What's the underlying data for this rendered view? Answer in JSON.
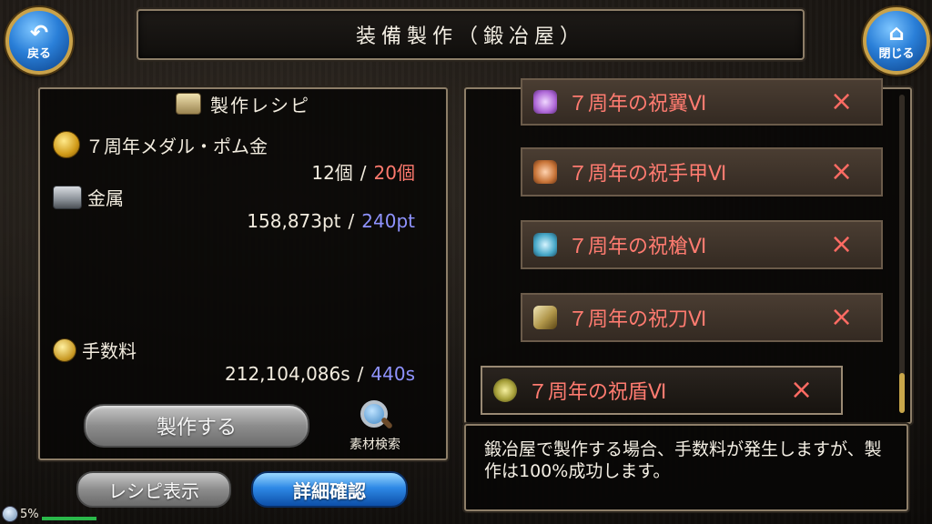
{
  "header": {
    "title": "装備製作（鍛冶屋）",
    "back_label": "戻る",
    "close_label": "閉じる"
  },
  "recipe": {
    "title": "製作レシピ",
    "materials": [
      {
        "icon": "medal-icon",
        "name": "７周年メダル・ポム金",
        "have": "12個",
        "need": "20個",
        "need_color": "#ff7a6e"
      },
      {
        "icon": "metal-ingot-icon",
        "name": "金属",
        "have": "158,873pt",
        "need": "240pt",
        "need_color": "#8f93ff"
      }
    ],
    "fee": {
      "icon": "coins-icon",
      "name": "手数料",
      "have": "212,104,086s",
      "need": "440s",
      "need_color": "#8f93ff"
    },
    "separator": "/",
    "craft_button": "製作する",
    "search_label": "素材検索",
    "recipe_button": "レシピ表示",
    "detail_button": "詳細確認"
  },
  "item_list": {
    "items": [
      {
        "label": "７周年の祝翼Ⅵ",
        "icon": "wing-icon",
        "available": "×"
      },
      {
        "label": "７周年の祝手甲Ⅵ",
        "icon": "gauntlet-icon",
        "available": "×"
      },
      {
        "label": "７周年の祝槍Ⅵ",
        "icon": "spear-icon",
        "available": "×"
      },
      {
        "label": "７周年の祝刀Ⅵ",
        "icon": "sword-icon",
        "available": "×"
      },
      {
        "label": "７周年の祝盾Ⅵ",
        "icon": "shield-icon",
        "available": "×",
        "selected": true
      }
    ]
  },
  "message": "鍛冶屋で製作する場合、手数料が発生しますが、製作は100%成功します。",
  "status": {
    "percent": "5%"
  }
}
